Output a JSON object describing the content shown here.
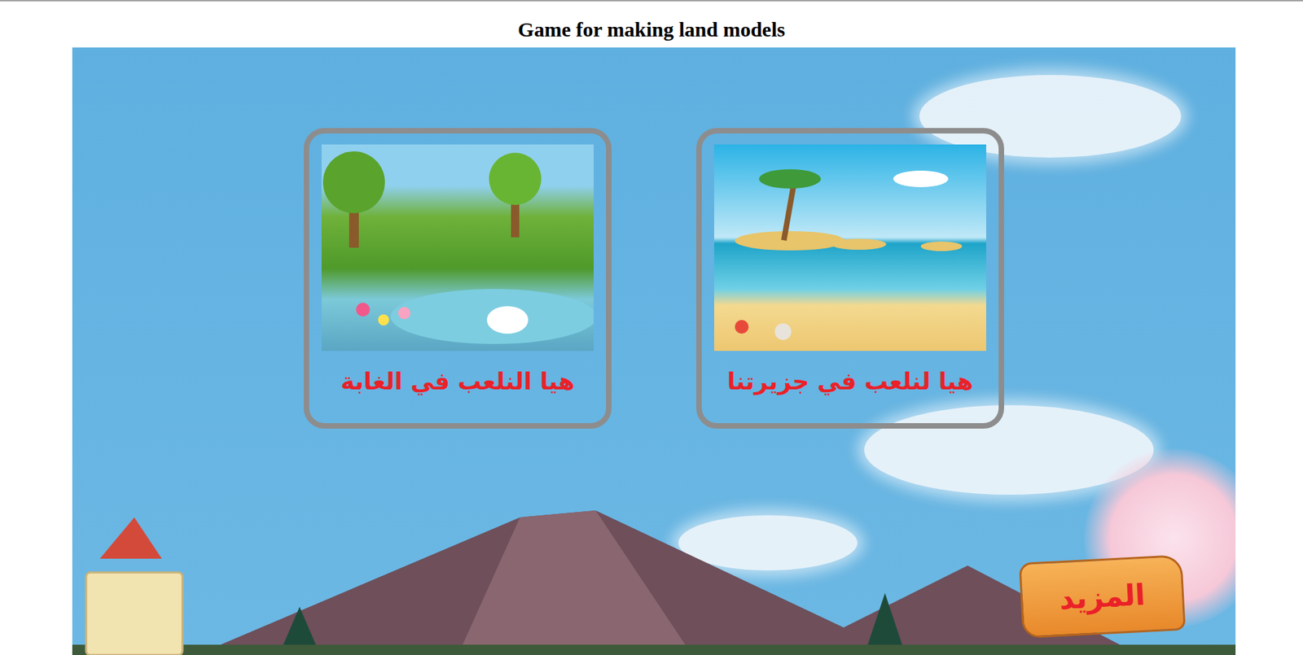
{
  "title": "Game for making land models",
  "cards": [
    {
      "label": "هيا النلعب في الغابة",
      "kind": "forest"
    },
    {
      "label": "هيا لنلعب في جزيرتنا",
      "kind": "island"
    }
  ],
  "more_button": {
    "label": "المزيد"
  }
}
